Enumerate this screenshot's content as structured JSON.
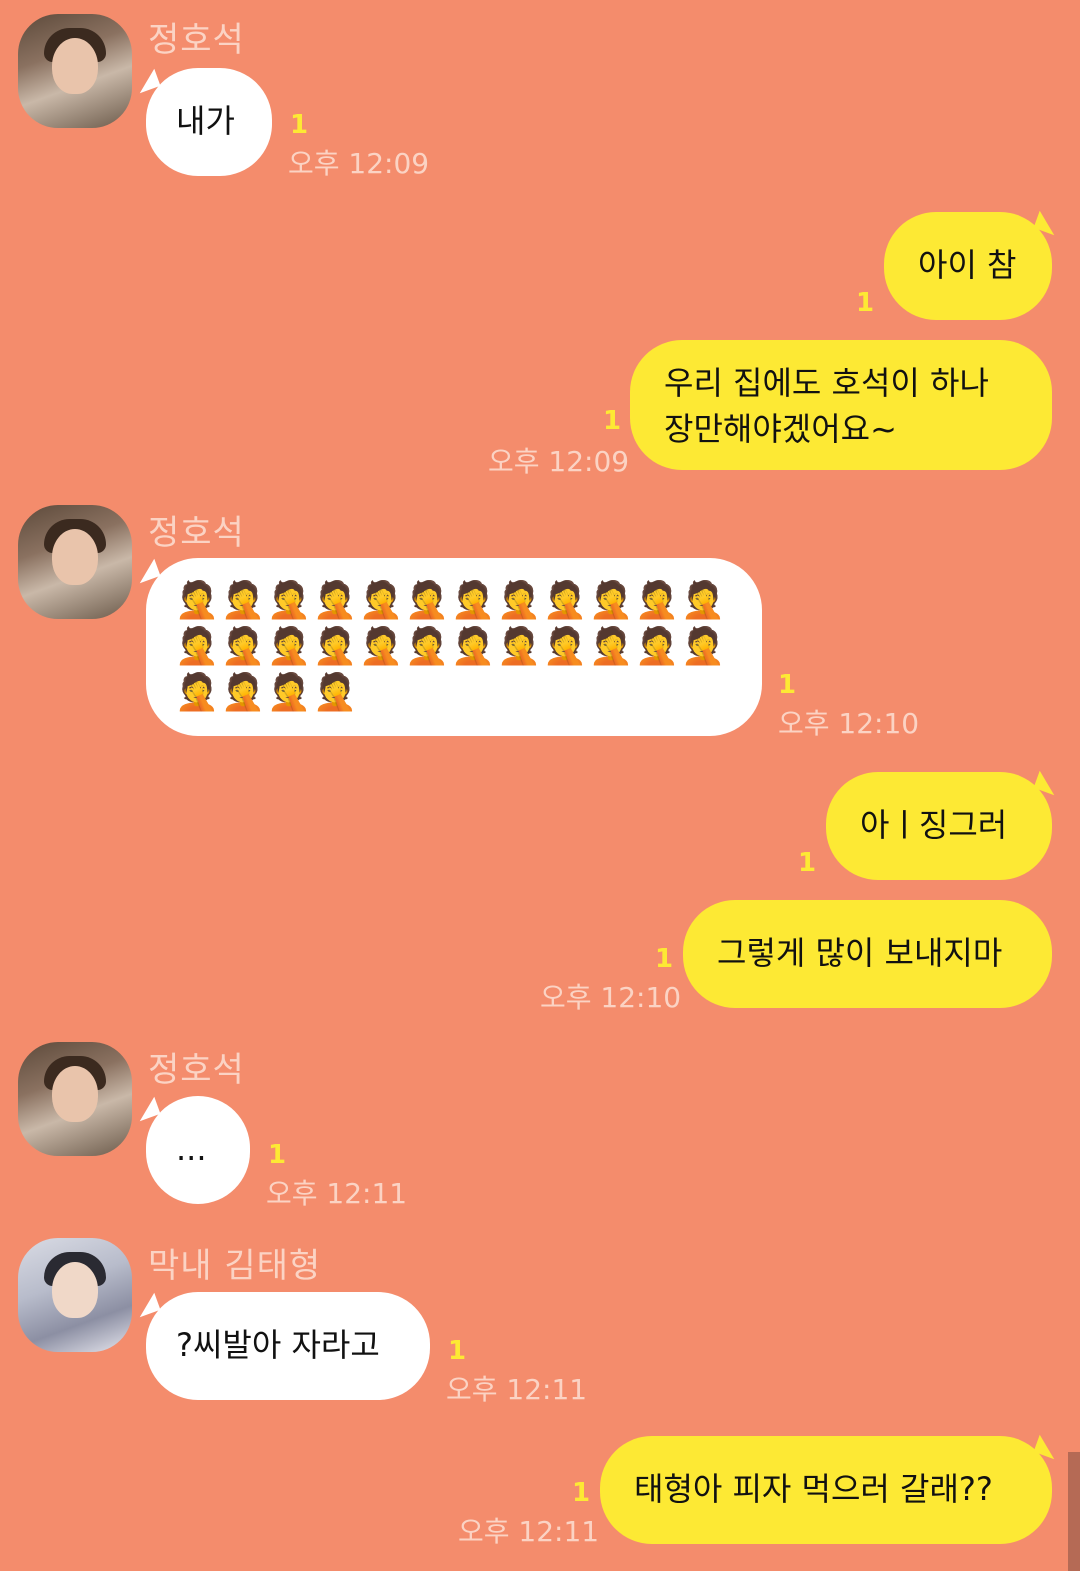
{
  "colors": {
    "background": "#f48c6c",
    "incoming_bubble": "#ffffff",
    "outgoing_bubble": "#fde934",
    "unread_marker": "#fde934",
    "meta_text": "#fbd3c4"
  },
  "messages": [
    {
      "sender": "정호석",
      "text": "내가",
      "unread": "1",
      "time": "오후 12:09"
    },
    {
      "text": "아이 참",
      "unread": "1"
    },
    {
      "text": "우리 집에도 호석이 하나\n장만해야겠어요~",
      "unread": "1",
      "time": "오후 12:09"
    },
    {
      "sender": "정호석",
      "emoji": "🤦",
      "emoji_count": 28,
      "unread": "1",
      "time": "오후 12:10"
    },
    {
      "text": "아ㅣ징그러",
      "unread": "1"
    },
    {
      "text": "그렇게 많이 보내지마",
      "unread": "1",
      "time": "오후 12:10"
    },
    {
      "sender": "정호석",
      "text": "...",
      "unread": "1",
      "time": "오후 12:11"
    },
    {
      "sender": "막내 김태형",
      "text": "?씨발아 자라고",
      "unread": "1",
      "time": "오후 12:11"
    },
    {
      "text": "태형아 피자 먹으러 갈래??",
      "unread": "1",
      "time": "오후 12:11"
    }
  ]
}
